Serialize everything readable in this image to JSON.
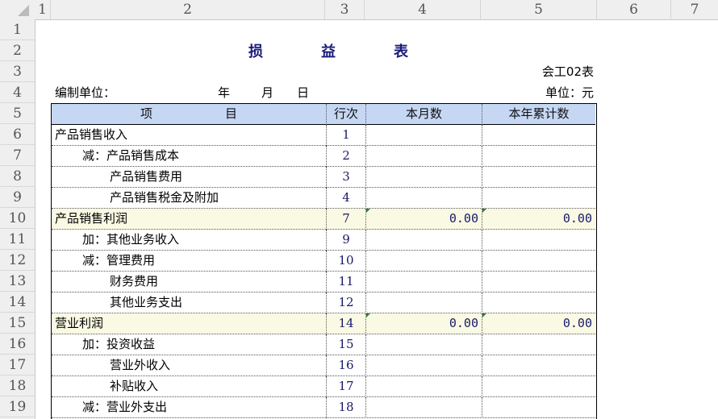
{
  "columns": [
    "1",
    "2",
    "3",
    "4",
    "5",
    "6",
    "7"
  ],
  "row_numbers": [
    "1",
    "2",
    "3",
    "4",
    "5",
    "6",
    "7",
    "8",
    "9",
    "10",
    "11",
    "12",
    "13",
    "14",
    "15",
    "16",
    "17",
    "18",
    "19"
  ],
  "title_chars": [
    "损",
    "益",
    "表"
  ],
  "form_code": "会工02表",
  "org_label": "编制单位：",
  "date_year": "年",
  "date_month": "月",
  "date_day": "日",
  "unit_label": "单位：元",
  "header": {
    "item": "项　　　　　　目",
    "line": "行次",
    "month": "本月数",
    "year": "本年累计数"
  },
  "rows": [
    {
      "label": "产品销售收入",
      "indent": 0,
      "line": "1",
      "month": "",
      "year": "",
      "highlight": false
    },
    {
      "label": "减：产品销售成本",
      "indent": 1,
      "line": "2",
      "month": "",
      "year": "",
      "highlight": false
    },
    {
      "label": "产品销售费用",
      "indent": 2,
      "line": "3",
      "month": "",
      "year": "",
      "highlight": false
    },
    {
      "label": "产品销售税金及附加",
      "indent": 2,
      "line": "4",
      "month": "",
      "year": "",
      "highlight": false
    },
    {
      "label": "产品销售利润",
      "indent": 0,
      "line": "7",
      "month": "0.00",
      "year": "0.00",
      "highlight": true
    },
    {
      "label": "加：其他业务收入",
      "indent": 1,
      "line": "9",
      "month": "",
      "year": "",
      "highlight": false
    },
    {
      "label": "减：管理费用",
      "indent": 1,
      "line": "10",
      "month": "",
      "year": "",
      "highlight": false
    },
    {
      "label": "财务费用",
      "indent": 2,
      "line": "11",
      "month": "",
      "year": "",
      "highlight": false
    },
    {
      "label": "其他业务支出",
      "indent": 2,
      "line": "12",
      "month": "",
      "year": "",
      "highlight": false
    },
    {
      "label": "营业利润",
      "indent": 0,
      "line": "14",
      "month": "0.00",
      "year": "0.00",
      "highlight": true
    },
    {
      "label": "加：投资收益",
      "indent": 1,
      "line": "15",
      "month": "",
      "year": "",
      "highlight": false
    },
    {
      "label": "营业外收入",
      "indent": 2,
      "line": "16",
      "month": "",
      "year": "",
      "highlight": false
    },
    {
      "label": "补贴收入",
      "indent": 2,
      "line": "17",
      "month": "",
      "year": "",
      "highlight": false
    },
    {
      "label": "减：营业外支出",
      "indent": 1,
      "line": "18",
      "month": "",
      "year": "",
      "highlight": false
    }
  ]
}
